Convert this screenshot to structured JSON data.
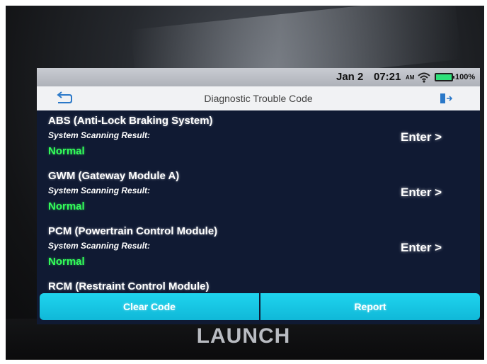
{
  "status_bar": {
    "date": "Jan 2",
    "time": "07:21",
    "ampm": "AM",
    "battery": "100%"
  },
  "header": {
    "title": "Diagnostic Trouble Code"
  },
  "modules": [
    {
      "name": "ABS (Anti-Lock Braking System)",
      "subtitle": "System Scanning Result:",
      "status": "Normal",
      "action": "Enter >"
    },
    {
      "name": "GWM (Gateway Module A)",
      "subtitle": "System Scanning Result:",
      "status": "Normal",
      "action": "Enter >"
    },
    {
      "name": "PCM (Powertrain Control Module)",
      "subtitle": "System Scanning Result:",
      "status": "Normal",
      "action": "Enter >"
    },
    {
      "name": "RCM (Restraint Control Module)"
    }
  ],
  "buttons": {
    "clear": "Clear Code",
    "report": "Report"
  },
  "brand": "LAUNCH",
  "colors": {
    "accent": "#10b8d8",
    "status_ok": "#33ff5a",
    "battery": "#2fe07a"
  },
  "icons": [
    "back-arrow-icon",
    "exit-icon",
    "wifi-icon",
    "battery-icon"
  ]
}
